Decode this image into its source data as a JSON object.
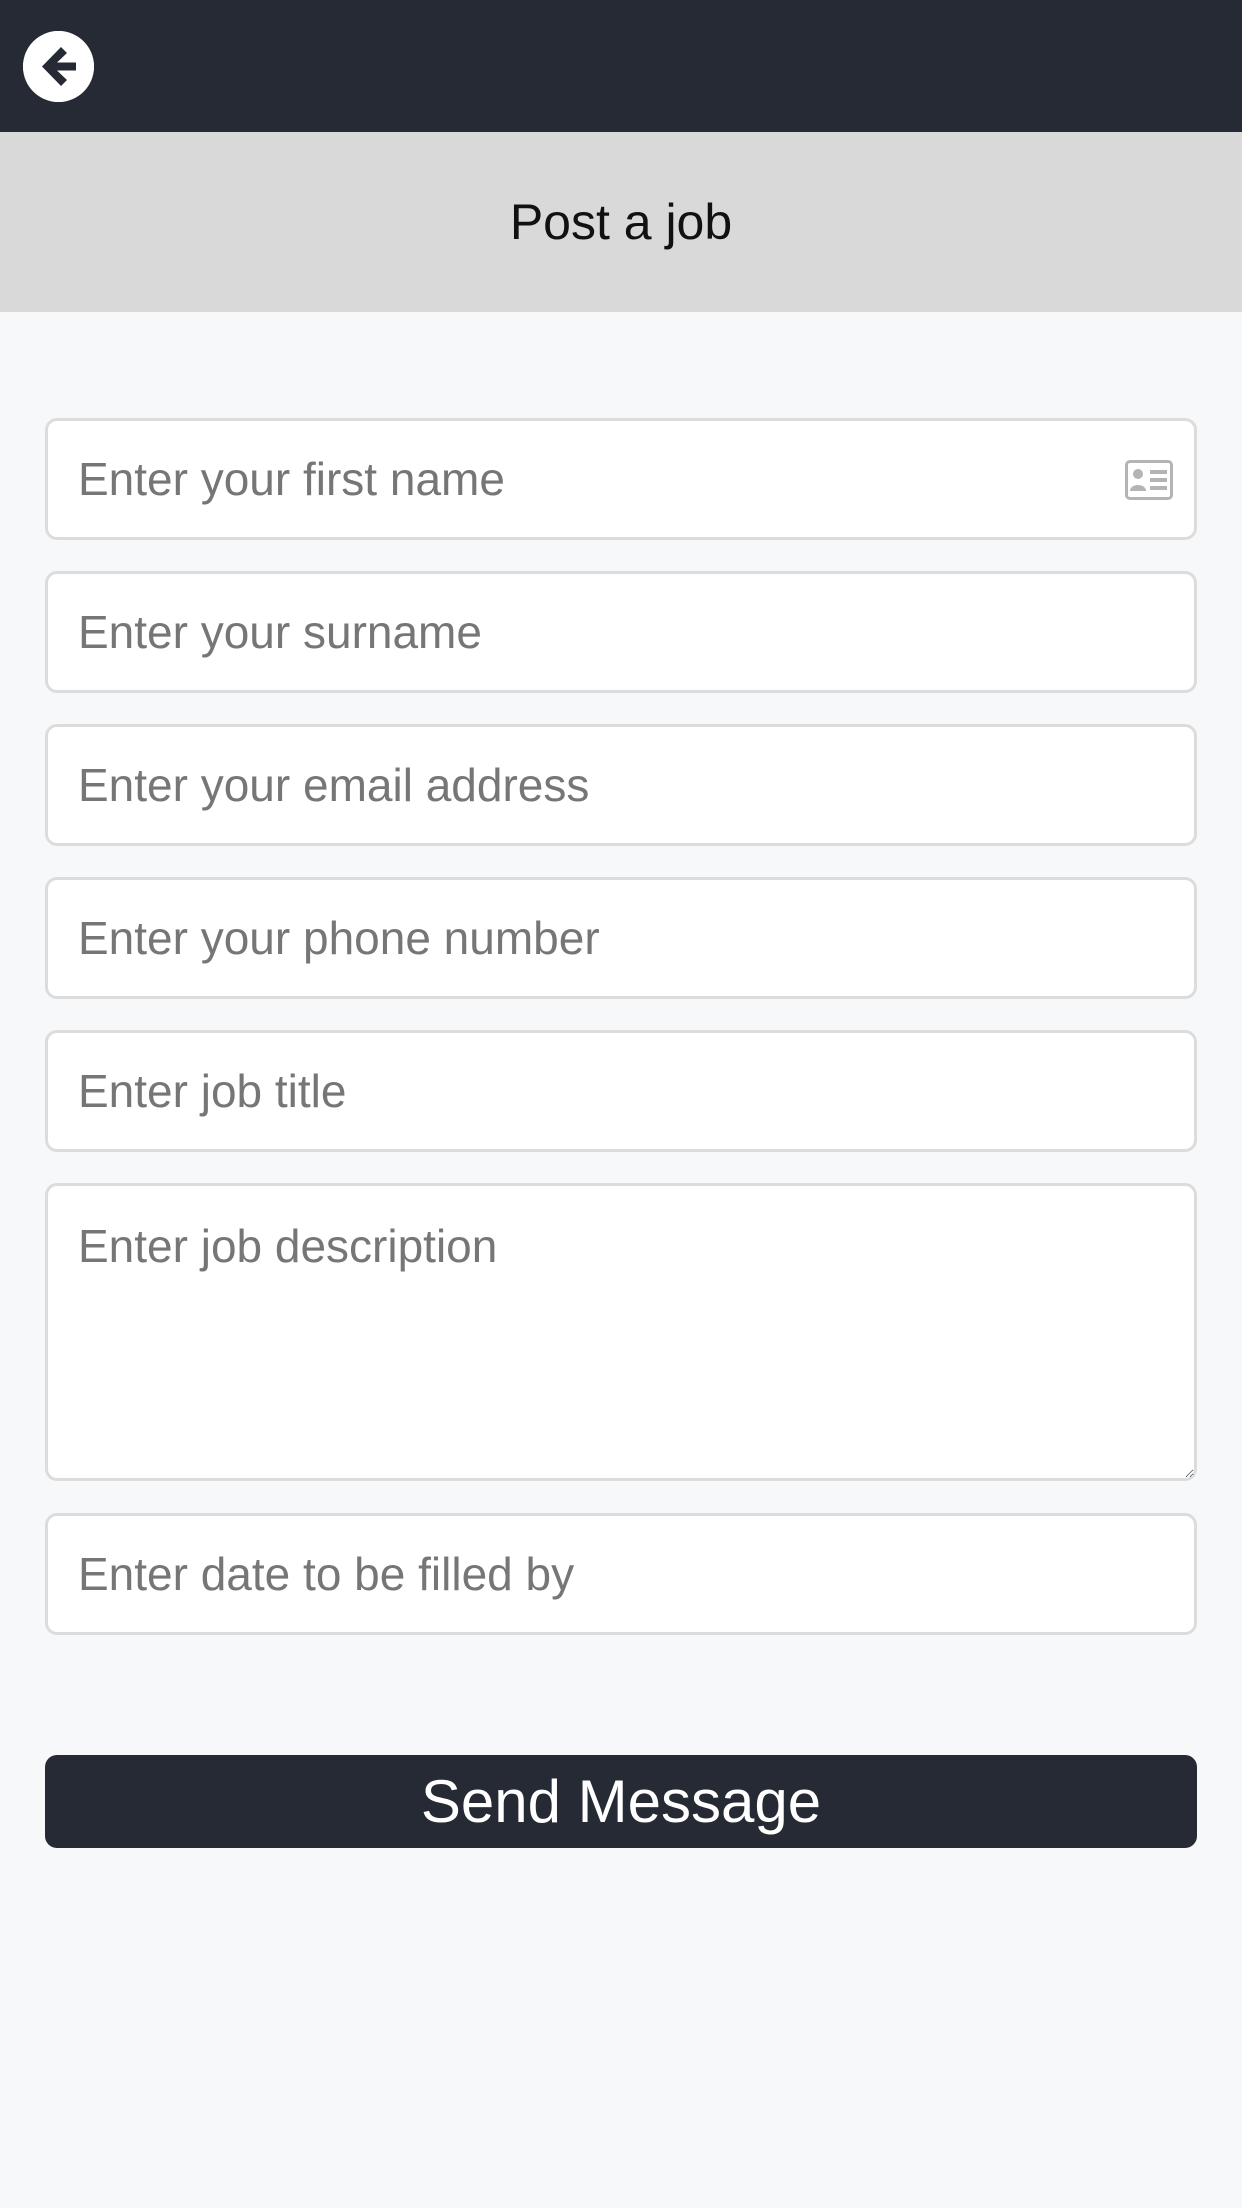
{
  "header": {
    "back_icon": "arrow-left-circle-icon"
  },
  "page": {
    "title": "Post a job"
  },
  "form": {
    "first_name_placeholder": "Enter your first name",
    "first_name_icon": "id-card-icon",
    "surname_placeholder": "Enter your surname",
    "email_placeholder": "Enter your email address",
    "phone_placeholder": "Enter your phone number",
    "job_title_placeholder": "Enter job title",
    "job_description_placeholder": "Enter job description",
    "date_placeholder": "Enter date to be filled by",
    "submit_label": "Send Message"
  },
  "colors": {
    "topbar": "#252a34",
    "title_bar": "#d9d9d9",
    "background": "#f7f8fa",
    "button": "#252a34"
  }
}
